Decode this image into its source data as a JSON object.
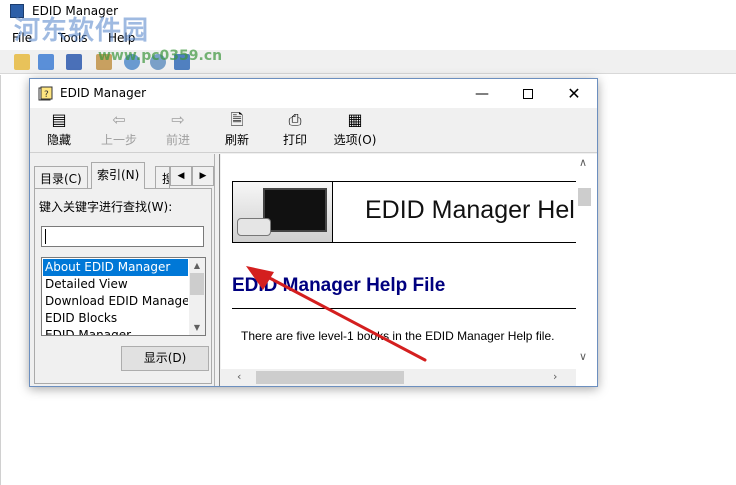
{
  "background_app": {
    "title": "EDID Manager",
    "menu": [
      "File",
      "Tools",
      "Help"
    ]
  },
  "watermark": {
    "text": "河东软件园",
    "url": "www.pc0359.cn"
  },
  "help_window": {
    "title": "EDID Manager",
    "toolbar": {
      "hide": "隐藏",
      "back": "上一步",
      "forward": "前进",
      "refresh": "刷新",
      "print": "打印",
      "options": "选项(O)"
    },
    "tabs": [
      "目录(C)",
      "索引(N)",
      "搜"
    ],
    "active_tab": "索引(N)",
    "search_label": "键入关键字进行查找(W):",
    "search_value": "",
    "index_items": [
      "About EDID Manager",
      "Detailed View",
      "Download EDID Manager",
      "EDID Blocks",
      "EDID Manager"
    ],
    "selected_index_item": "About EDID Manager",
    "display_button": "显示(D)"
  },
  "content": {
    "banner_title": "EDID Manager Help",
    "heading": "EDID Manager Help File",
    "body": "There are five level-1 books in the EDID Manager Help file."
  },
  "colors": {
    "selection": "#0078d7",
    "heading": "#00007f",
    "annotation_arrow": "#d41f1f"
  }
}
